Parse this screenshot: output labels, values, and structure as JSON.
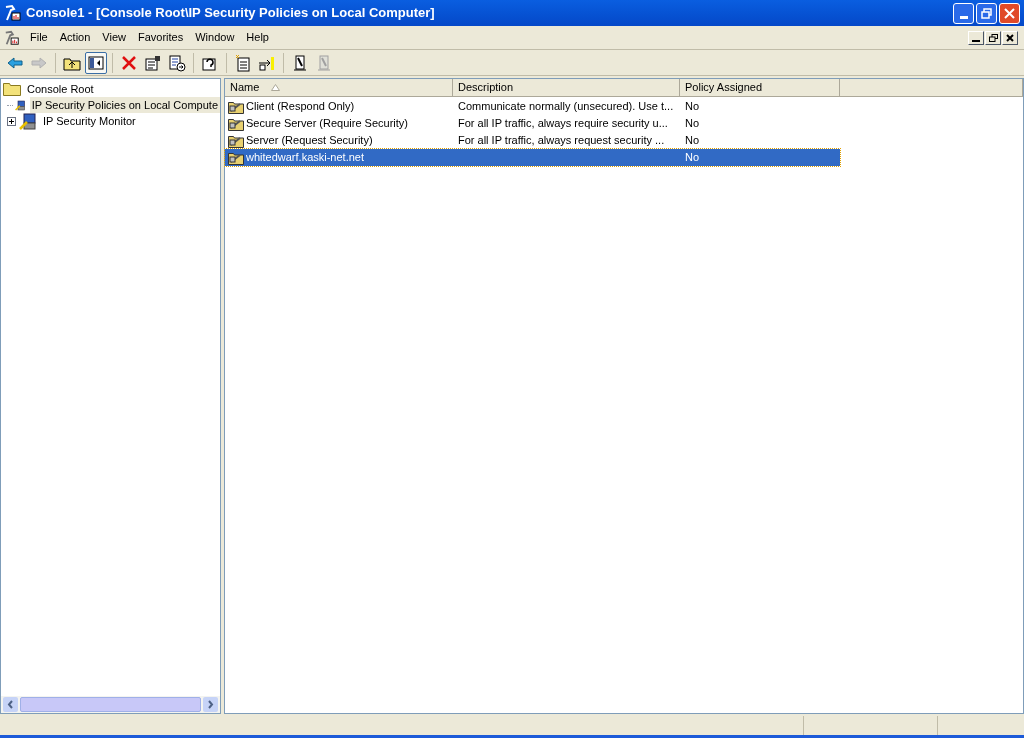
{
  "window": {
    "title": "Console1 - [Console Root\\IP Security Policies on Local Computer]"
  },
  "menu": [
    {
      "label": "File"
    },
    {
      "label": "Action"
    },
    {
      "label": "View"
    },
    {
      "label": "Favorites"
    },
    {
      "label": "Window"
    },
    {
      "label": "Help"
    }
  ],
  "toolbar": [
    {
      "kind": "back",
      "disabled": false,
      "selected": false
    },
    {
      "kind": "forward",
      "disabled": true,
      "selected": false
    },
    {
      "kind": "sep"
    },
    {
      "kind": "up",
      "disabled": false,
      "selected": false
    },
    {
      "kind": "tree",
      "disabled": false,
      "selected": true
    },
    {
      "kind": "sep"
    },
    {
      "kind": "delete",
      "disabled": false,
      "selected": false
    },
    {
      "kind": "properties",
      "disabled": false,
      "selected": false
    },
    {
      "kind": "export",
      "disabled": false,
      "selected": false
    },
    {
      "kind": "sep"
    },
    {
      "kind": "help",
      "disabled": false,
      "selected": false
    },
    {
      "kind": "sep"
    },
    {
      "kind": "new",
      "disabled": false,
      "selected": false
    },
    {
      "kind": "assign",
      "disabled": false,
      "selected": false
    },
    {
      "kind": "sep"
    },
    {
      "kind": "unassign",
      "disabled": false,
      "selected": false
    },
    {
      "kind": "unassign",
      "disabled": true,
      "selected": false
    }
  ],
  "tree": [
    {
      "label": "Console Root",
      "selected": false,
      "children": [
        {
          "label": "IP Security Policies on Local Compute",
          "selected": true
        },
        {
          "label": "IP Security Monitor",
          "selected": false,
          "expanded": false
        }
      ]
    }
  ],
  "table": {
    "columns": [
      {
        "label": "Name",
        "sorted": true
      },
      {
        "label": "Description",
        "sorted": false
      },
      {
        "label": "Policy Assigned",
        "sorted": false
      },
      {
        "sorted": false
      }
    ],
    "rows": [
      {
        "name": "Client (Respond Only)",
        "description": "Communicate normally (unsecured). Use t...",
        "policy_assigned": "No",
        "selected": false
      },
      {
        "name": "Secure Server (Require Security)",
        "description": "For all IP traffic, always require security u...",
        "policy_assigned": "No",
        "selected": false
      },
      {
        "name": "Server (Request Security)",
        "description": "For all IP traffic, always request security ...",
        "policy_assigned": "No",
        "selected": false
      },
      {
        "name": "whitedwarf.kaski-net.net",
        "description": "",
        "policy_assigned": "No",
        "selected": true
      }
    ]
  }
}
